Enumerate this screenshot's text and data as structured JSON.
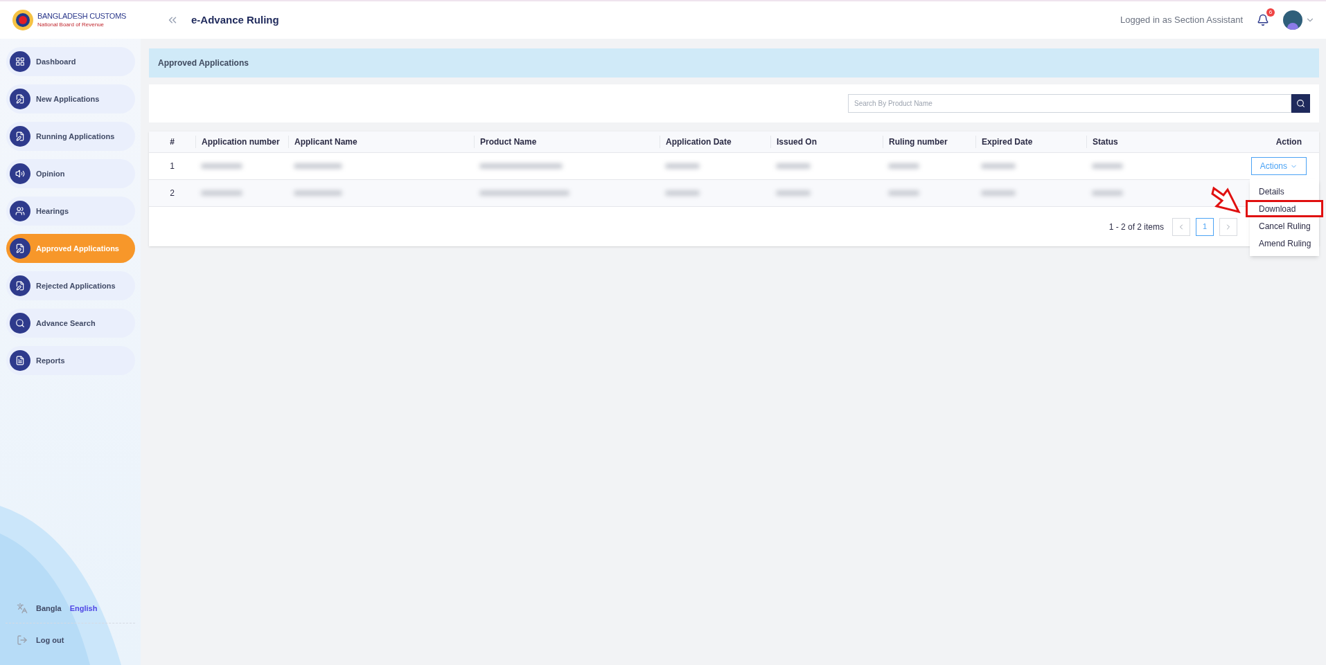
{
  "header": {
    "logo_title": "BANGLADESH CUSTOMS",
    "logo_subtitle": "National Board of Revenue",
    "app_title": "e-Advance Ruling",
    "user_label": "Logged in as Section Assistant",
    "notification_count": "6"
  },
  "sidebar": {
    "items": [
      {
        "label": "Dashboard",
        "selected": false
      },
      {
        "label": "New Applications",
        "selected": false
      },
      {
        "label": "Running Applications",
        "selected": false
      },
      {
        "label": "Opinion",
        "selected": false
      },
      {
        "label": "Hearings",
        "selected": false
      },
      {
        "label": "Approved Applications",
        "selected": true
      },
      {
        "label": "Rejected Applications",
        "selected": false
      },
      {
        "label": "Advance Search",
        "selected": false
      },
      {
        "label": "Reports",
        "selected": false
      }
    ],
    "languages": [
      {
        "label": "Bangla",
        "selected": false
      },
      {
        "label": "English",
        "selected": true
      }
    ],
    "logout": "Log out"
  },
  "page_title": "Approved Applications",
  "search": {
    "placeholder": "Search By Product Name"
  },
  "table": {
    "columns": [
      "#",
      "Application number",
      "Applicant Name",
      "Product Name",
      "Application Date",
      "Issued On",
      "Ruling number",
      "Expired Date",
      "Status",
      "Action"
    ],
    "rows": [
      {
        "number": "1"
      },
      {
        "number": "2"
      }
    ]
  },
  "actions_button": "Actions",
  "menu": [
    {
      "label": "Details",
      "highlighted": false
    },
    {
      "label": "Download",
      "highlighted": true
    },
    {
      "label": "Cancel Ruling",
      "highlighted": false
    },
    {
      "label": "Amend Ruling",
      "highlighted": false
    }
  ],
  "pagination": {
    "summary": "1 - 2 of 2 items",
    "pages": [
      {
        "label": "1",
        "selected": true
      }
    ]
  }
}
